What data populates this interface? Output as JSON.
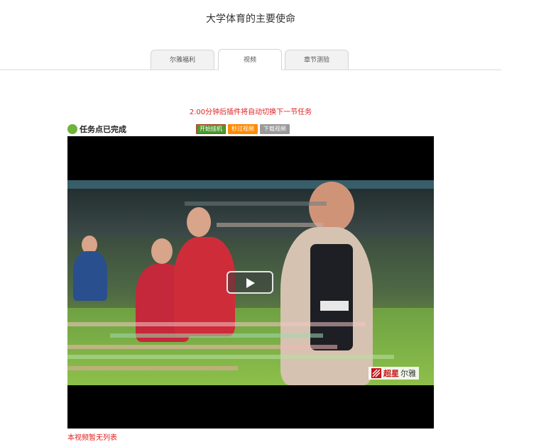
{
  "page": {
    "title": "大学体育的主要使命"
  },
  "tabs": [
    {
      "label": "尔雅福利",
      "active": false
    },
    {
      "label": "视频",
      "active": true
    },
    {
      "label": "章节测验",
      "active": false
    }
  ],
  "notice": "2.00分钟后插件将自动切换下一节任务",
  "status": {
    "text": "任务点已完成",
    "color": "#6fb33a"
  },
  "controls": {
    "start_label": "开始挂机",
    "skip_label": "秒过视频",
    "download_label": "下载视频"
  },
  "player": {
    "play_icon": "play-icon",
    "watermark": {
      "brand": "超星",
      "product": "尔雅"
    }
  },
  "footer": {
    "link_text": "本视频暂无列表"
  },
  "colors": {
    "accent_red": "#e02020",
    "btn_green": "#4a9a2c",
    "btn_orange": "#ff8a00",
    "btn_gray": "#9a9a9a"
  }
}
